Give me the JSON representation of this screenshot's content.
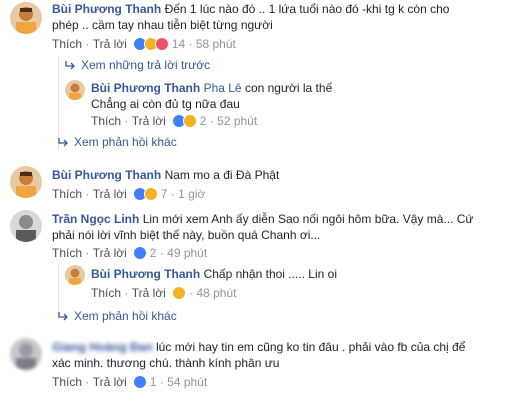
{
  "comments": [
    {
      "author": "Bùi Phương Thanh",
      "text_line1": "Đến 1 lúc nào đó .. 1 lứa tuổi nào đó -khi tg k còn cho",
      "text_line2": "phép .. cầm tay nhau tiễn biệt từng người",
      "like": "Thích",
      "reply": "Trả lời",
      "reaction_count": "14",
      "time": "58 phút",
      "reactions": [
        "like",
        "sad",
        "love"
      ]
    }
  ],
  "prev_replies": "Xem những trả lời trước",
  "reply1": {
    "author": "Bùi Phương Thanh",
    "tag": "Pha Lê",
    "text_line1": "con người la thế",
    "text_line2": "Chẳng ai còn đủ tg nữa đau",
    "like": "Thích",
    "reply": "Trả lời",
    "reaction_count": "2",
    "time": "52 phút",
    "reactions": [
      "like",
      "sad"
    ]
  },
  "more1": "Xem phản hồi khác",
  "comment2": {
    "author": "Bùi Phương Thanh",
    "text": "Nam mo a đi Đà Phật",
    "like": "Thích",
    "reply": "Trả lời",
    "reaction_count": "7",
    "time": "1 giờ",
    "reactions": [
      "like",
      "sad"
    ]
  },
  "comment3": {
    "author": "Trần Ngọc Linh",
    "text_line1": "Lin mới xem Anh ấy diễn Sao nối ngôi hôm bữa. Vậy mà... Cứ",
    "text_line2": "phải nói lời vĩnh biệt thế này, buồn quá Chanh ơi...",
    "like": "Thích",
    "reply": "Trả lời",
    "reaction_count": "2",
    "time": "49 phút",
    "reactions": [
      "like"
    ]
  },
  "reply2": {
    "author": "Bùi Phương Thanh",
    "text": "Chấp nhận thoi ..... Lin oi",
    "like": "Thích",
    "reply": "Trả lời",
    "reaction_count": "",
    "time": "48 phút",
    "reactions": [
      "sad"
    ]
  },
  "more2": "Xem phản hồi khác",
  "comment4": {
    "author": "Giang Hoàng Đan",
    "text_line1": "lúc mới hay tin em cũng ko tin đâu . phải vào fb của chị để",
    "text_line2": "xác minh. thương chú. thành kính phân ưu",
    "like": "Thích",
    "reply": "Trả lời",
    "reaction_count": "1",
    "time": "54 phút",
    "reactions": [
      "like"
    ]
  },
  "colors": {
    "link": "#365899",
    "meta": "#90949c",
    "text": "#1d2129"
  }
}
